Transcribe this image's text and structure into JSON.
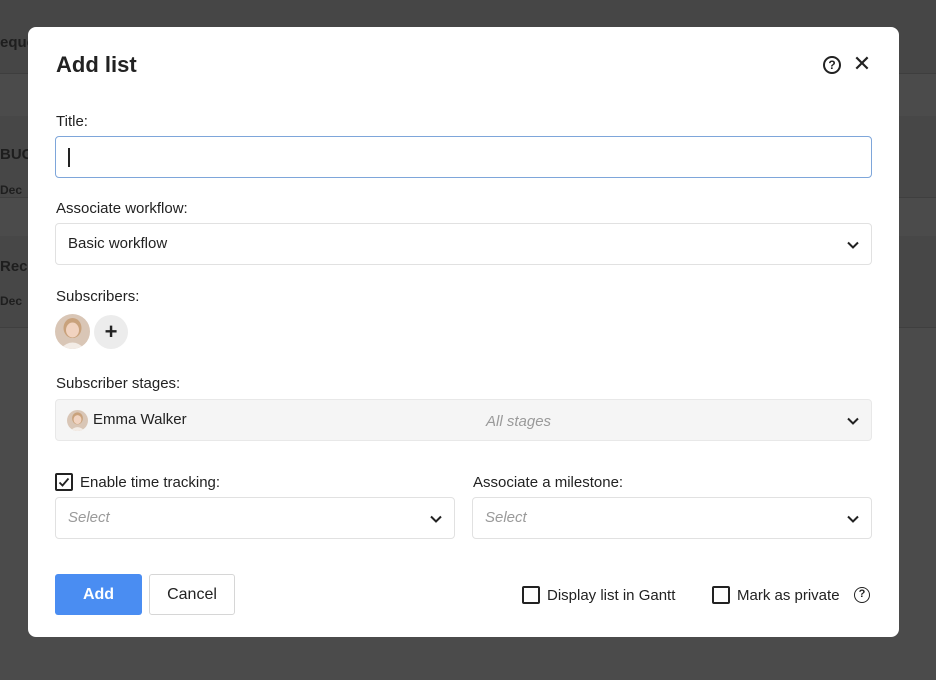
{
  "background": {
    "items": [
      "eque",
      "BUG",
      "Dec",
      "Rec",
      "Dec"
    ]
  },
  "modal": {
    "title": "Add list",
    "title_field": {
      "label": "Title:",
      "value": ""
    },
    "workflow": {
      "label": "Associate workflow:",
      "value": "Basic workflow"
    },
    "subscribers": {
      "label": "Subscribers:",
      "add_label": "+"
    },
    "subscriber_stages": {
      "label": "Subscriber stages:",
      "name": "Emma Walker",
      "placeholder": "All stages"
    },
    "time_tracking": {
      "label": "Enable time tracking:",
      "checked": true,
      "placeholder": "Select"
    },
    "milestone": {
      "label": "Associate a milestone:",
      "placeholder": "Select"
    },
    "buttons": {
      "add": "Add",
      "cancel": "Cancel"
    },
    "options": {
      "gantt": "Display list in Gantt",
      "private": "Mark as private"
    }
  },
  "colors": {
    "primary": "#4a8df2",
    "focus_border": "#7ea6da",
    "overlay": "#4a4a4a"
  }
}
